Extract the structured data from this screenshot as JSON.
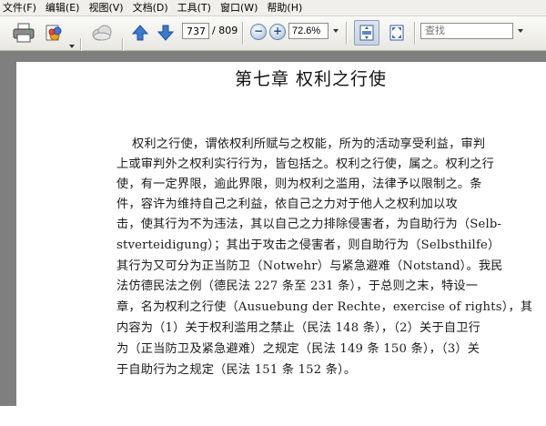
{
  "menu": [
    "文件(F)",
    "编辑(E)",
    "视图(V)",
    "文档(D)",
    "工具(T)",
    "窗口(W)",
    "帮助(H)"
  ],
  "toolbar": {
    "current_page": "737",
    "page_total": "/ 809",
    "zoom_value": "72.6%",
    "search_placeholder": "查找",
    "icons": [
      "print-icon",
      "open-icon",
      "cloud-icon",
      "prev-page-icon",
      "next-page-icon",
      "zoom-out-icon",
      "zoom-in-icon",
      "fit-page-icon",
      "full-screen-icon"
    ]
  },
  "document": {
    "chapter_title": "第七章    权利之行使",
    "lines": [
      "权利之行使，谓依权利所赋与之权能，所为的活动享受利益，审判",
      "上或审判外之权利实行行为，皆包括之。权利之行使，属之。权利之行",
      "使，有一定界限，逾此界限，则为权利之滥用，法律予以限制之。条",
      "件，容许为维持自己之利益，依自己之力对于他人之权利加以攻",
      "击，使其行为不为违法，其以自己之力排除侵害者，为自助行为（Selb-",
      "stverteidigung）；其出于攻击之侵害者，则自助行为（Selbsthilfe）",
      "其行为又可分为正当防卫（Notwehr）与紧急避难（Notstand）。我民",
      "法仿德民法之例（德民法 227 条至 231 条），于总则之末，特设一",
      "章，名为权利之行使（Ausuebung der Rechte，exercise of rights），其",
      "内容为（1）关于权利滥用之禁止（民法 148 条），（2）关于自卫行",
      "为（正当防卫及紧急避难）之规定（民法 149 条 150 条），（3）关",
      "于自助行为之规定（民法 151 条 152 条）。"
    ]
  }
}
